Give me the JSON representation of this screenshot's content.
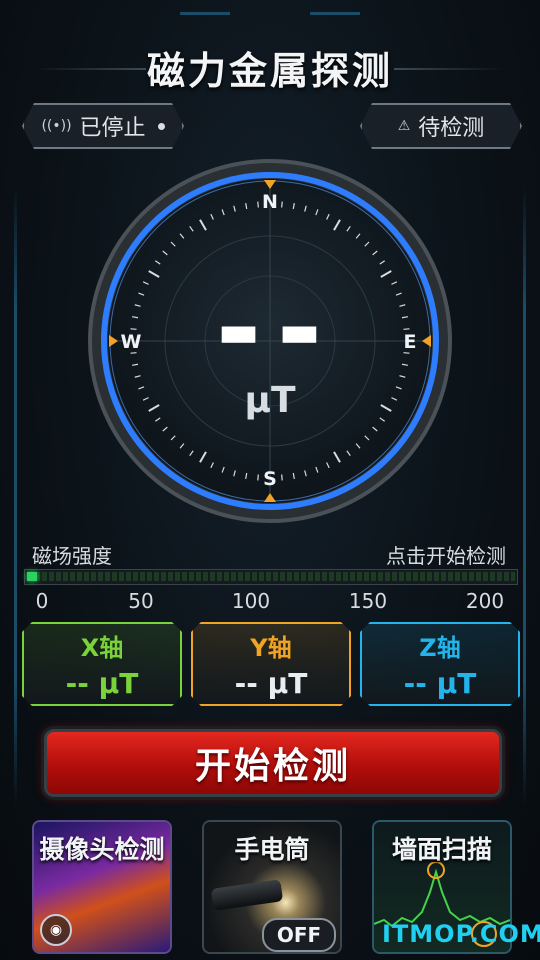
{
  "app": {
    "title": "磁力金属探测"
  },
  "status": {
    "state_label": "已停止",
    "mode_label": "待检测"
  },
  "compass": {
    "north": "N",
    "south": "S",
    "east": "E",
    "west": "W"
  },
  "reading": {
    "value": "▬ ▬",
    "unit": "μT"
  },
  "meter": {
    "label": "磁场强度",
    "hint": "点击开始检测",
    "ticks": [
      "0",
      "50",
      "100",
      "150",
      "200"
    ],
    "level_fraction": 0.02
  },
  "axes": [
    {
      "name": "X轴",
      "value": "-- μT",
      "color": "#7ad33a"
    },
    {
      "name": "Y轴",
      "value": "-- μT",
      "color": "#f0a324"
    },
    {
      "name": "Z轴",
      "value": "-- μT",
      "color": "#22b4ea"
    }
  ],
  "start_button": {
    "label": "开始检测"
  },
  "tools": {
    "camera": {
      "label": "摄像头检测"
    },
    "flashlight": {
      "label": "手电筒",
      "toggle": "OFF"
    },
    "wall": {
      "label": "墙面扫描"
    }
  },
  "watermark": "ITMOP.COM",
  "colors": {
    "accent_blue": "#2f7dff",
    "alert_red": "#d01a14",
    "meter_green": "#2bd25f"
  }
}
